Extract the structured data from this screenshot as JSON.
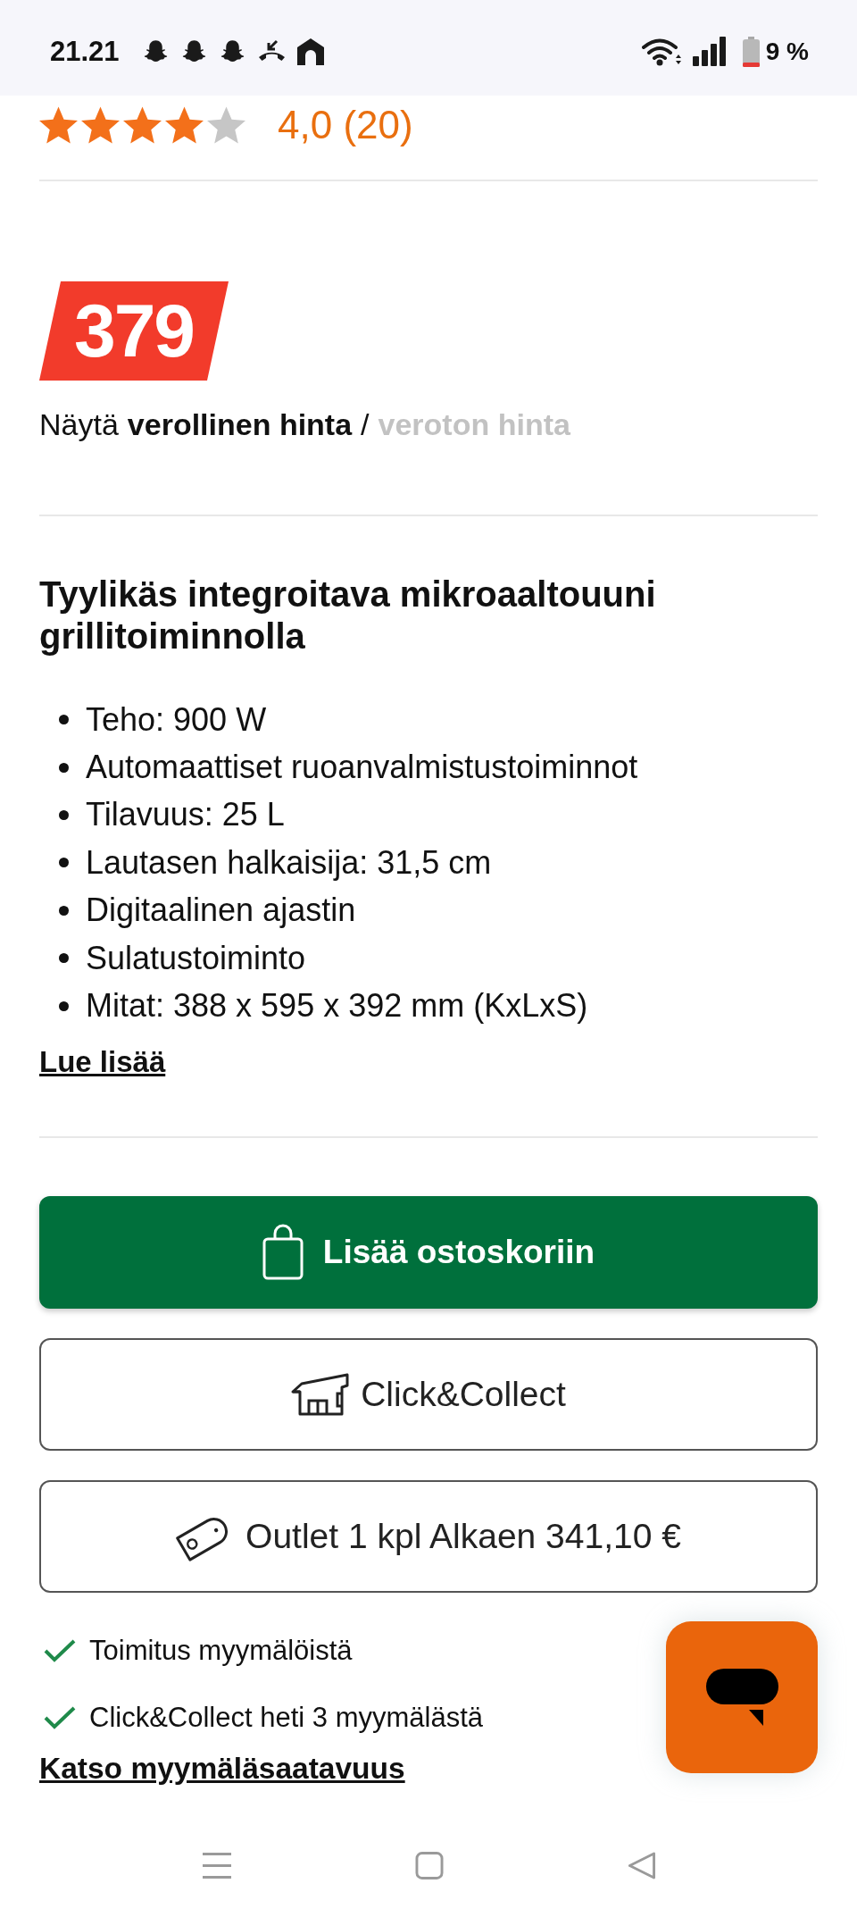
{
  "status_bar": {
    "time": "21.21",
    "battery_text": "9 %"
  },
  "rating": {
    "stars": 4,
    "text": "4,0 (20)"
  },
  "price": {
    "amount": "379"
  },
  "price_toggle": {
    "prefix": "Näytä",
    "separator": "/",
    "options": [
      {
        "label": "verollinen hinta",
        "selected": true
      },
      {
        "label": "veroton hinta",
        "selected": false
      }
    ]
  },
  "description": {
    "title": "Tyylikäs integroitava mikroaaltouuni grillitoiminnolla",
    "features": [
      "Teho: 900 W",
      "Automaattiset ruoanvalmistustoiminnot",
      "Tilavuus: 25 L",
      "Lautasen halkaisija: 31,5 cm",
      "Digitaalinen ajastin",
      "Sulatustoiminto",
      "Mitat: 388 x 595 x 392 mm (KxLxS)"
    ],
    "read_more": "Lue lisää"
  },
  "actions": [
    {
      "kind": "cart",
      "label": "Lisää ostoskoriin"
    },
    {
      "kind": "pickup",
      "label": "Click&Collect"
    },
    {
      "kind": "outlet",
      "label": "Outlet 1 kpl Alkaen 341,10 €"
    }
  ],
  "availability": [
    {
      "text": "Toimitus myymälöistä",
      "available": true
    },
    {
      "text": "Click&Collect heti 3 myymälästä",
      "available": true
    }
  ],
  "store_link": "Katso myymäläsaatavuus"
}
